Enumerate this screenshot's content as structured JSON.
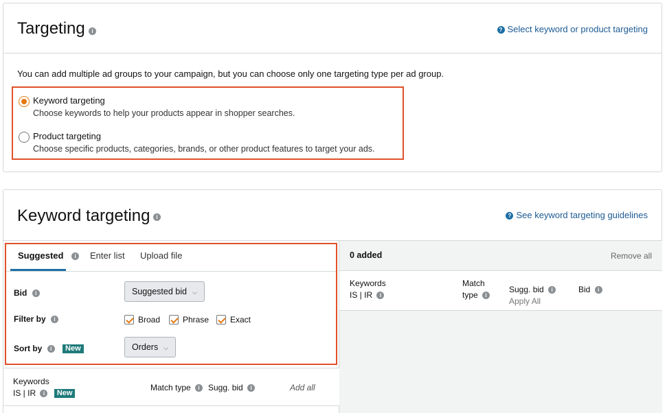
{
  "targeting": {
    "title": "Targeting",
    "help_link": "Select keyword or product targeting",
    "description": "You can add multiple ad groups to your campaign, but you can choose only one targeting type per ad group.",
    "options": [
      {
        "label": "Keyword targeting",
        "sublabel": "Choose keywords to help your products appear in shopper searches.",
        "selected": true
      },
      {
        "label": "Product targeting",
        "sublabel": "Choose specific products, categories, brands, or other product features to target your ads.",
        "selected": false
      }
    ]
  },
  "keyword_targeting": {
    "title": "Keyword targeting",
    "help_link": "See keyword targeting guidelines",
    "tabs": [
      "Suggested",
      "Enter list",
      "Upload file"
    ],
    "active_tab": "Suggested",
    "bid_label": "Bid",
    "bid_value": "Suggested bid",
    "filter_label": "Filter by",
    "filters": [
      {
        "label": "Broad",
        "checked": true
      },
      {
        "label": "Phrase",
        "checked": true
      },
      {
        "label": "Exact",
        "checked": true
      }
    ],
    "sort_label": "Sort by",
    "new_badge": "New",
    "sort_value": "Orders",
    "list_header": {
      "keywords": "Keywords",
      "is_ir": "IS | IR",
      "new_badge": "New",
      "match_type": "Match type",
      "sugg_bid": "Sugg. bid",
      "add_all": "Add all"
    },
    "added": {
      "count_label": "0 added",
      "remove_all": "Remove all",
      "keywords": "Keywords",
      "is_ir": "IS | IR",
      "match": "Match",
      "type": "type",
      "sugg_bid": "Sugg. bid",
      "apply_all": "Apply All",
      "bid": "Bid"
    }
  },
  "colors": {
    "highlight": "#e0502a",
    "accent": "#e47911",
    "link": "#1d5a93",
    "badge": "#1f7a7a"
  }
}
